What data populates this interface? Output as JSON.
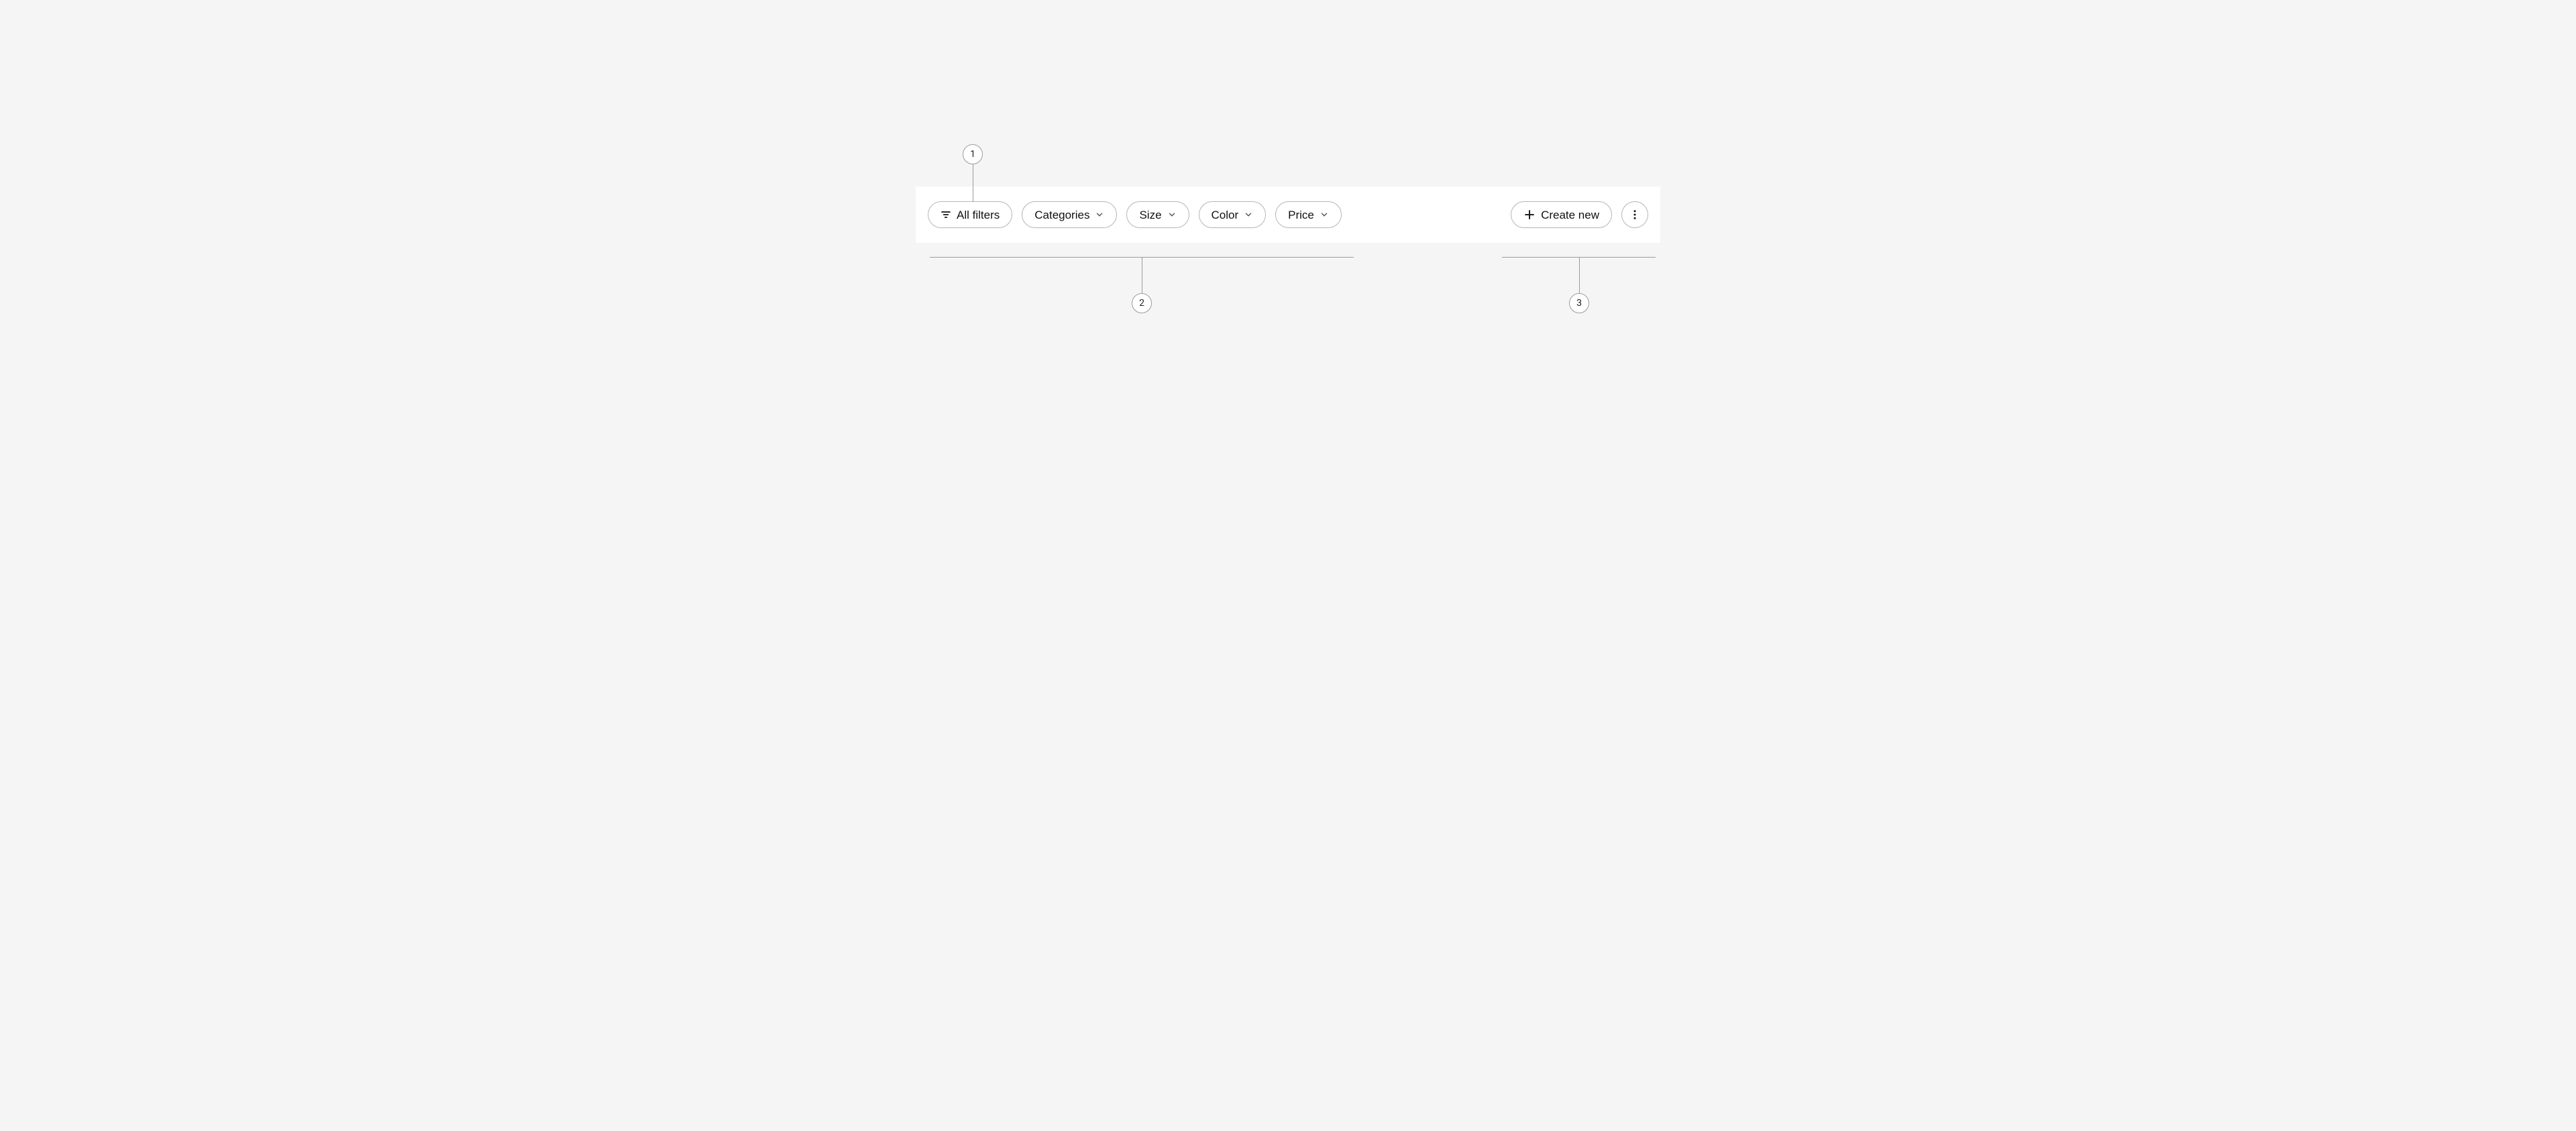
{
  "filters": {
    "all_label": "All filters",
    "chips": [
      {
        "label": "Categories"
      },
      {
        "label": "Size"
      },
      {
        "label": "Color"
      },
      {
        "label": "Price"
      }
    ]
  },
  "actions": {
    "create_label": "Create new"
  },
  "annotations": {
    "n1": "1",
    "n2": "2",
    "n3": "3"
  }
}
